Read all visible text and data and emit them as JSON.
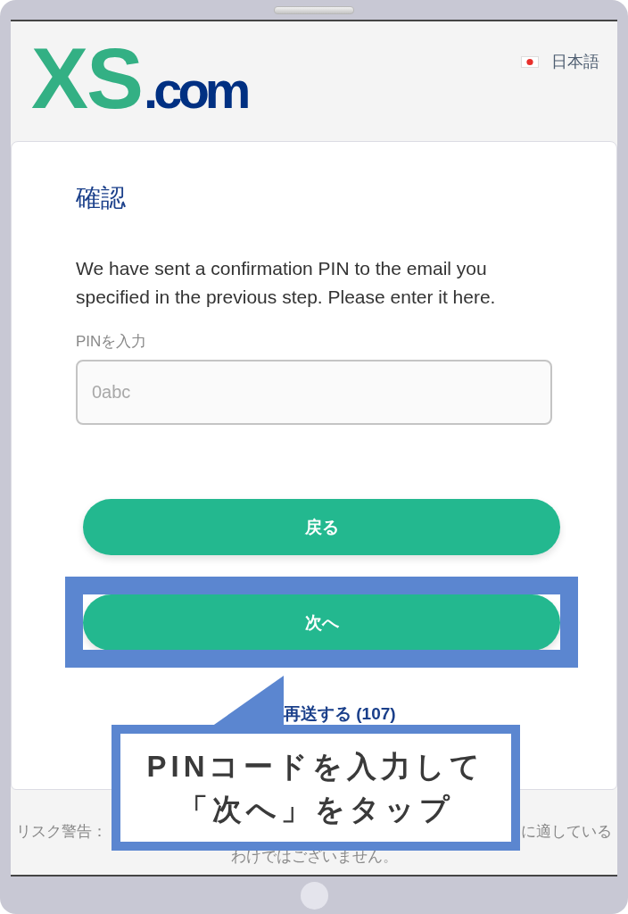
{
  "header": {
    "logo": {
      "mark": "XS",
      "suffix": ".com"
    },
    "language": {
      "label": "日本語"
    }
  },
  "form": {
    "title": "確認",
    "message": "We have sent a confirmation PIN to the email you specified in the previous step. Please enter it here.",
    "pin_field": {
      "label": "PINを入力",
      "placeholder": "0abc"
    },
    "buttons": [
      {
        "label": "戻る",
        "highlighted": false
      },
      {
        "label": "次へ",
        "highlighted": true
      }
    ],
    "resend_link": "再送する (107)"
  },
  "footer": {
    "risk_warning_start": "リスク警告：",
    "risk_warning_end": "に適している",
    "risk_warning_last": "わけではございません。"
  },
  "callout": {
    "lines": [
      "PINコードを入力して",
      "「次へ」をタップ"
    ]
  }
}
